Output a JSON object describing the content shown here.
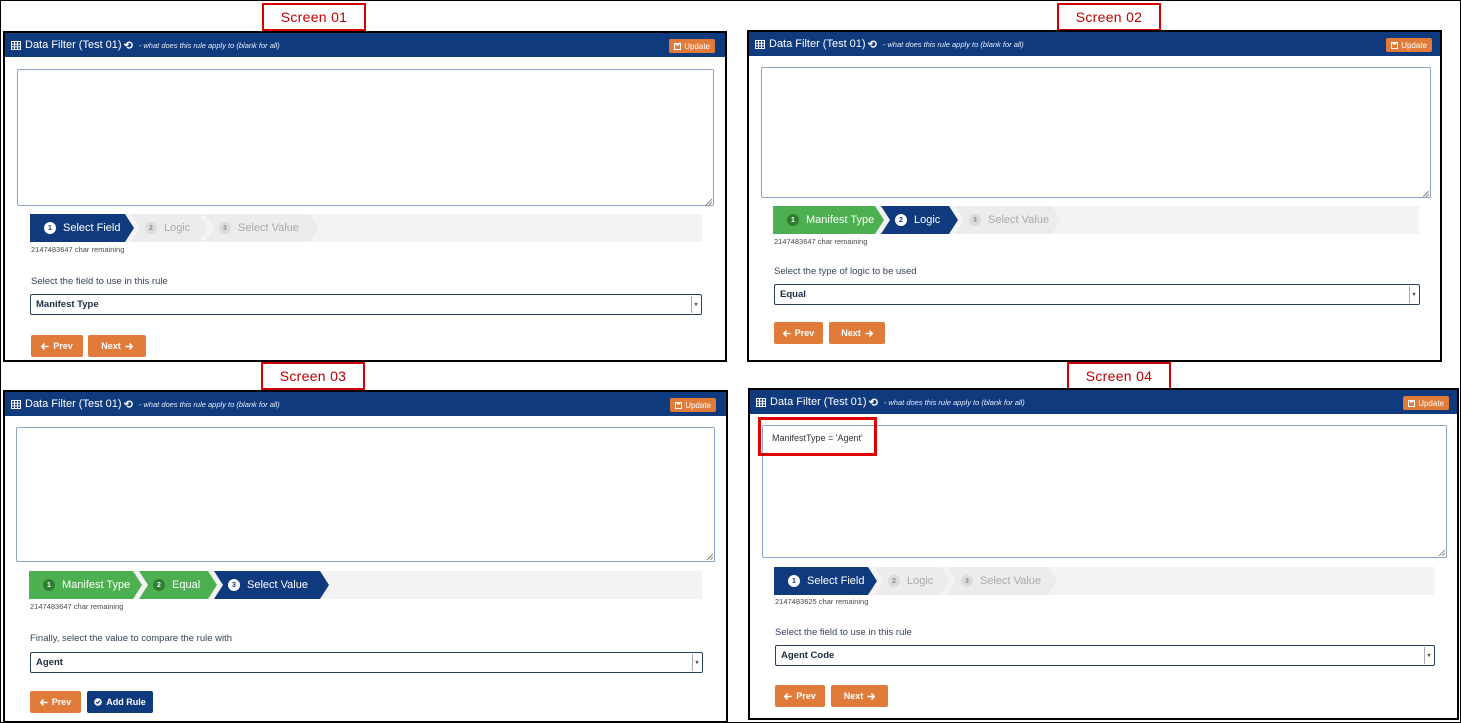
{
  "labels": {
    "screen1": "Screen 01",
    "screen2": "Screen 02",
    "screen3": "Screen 03",
    "screen4": "Screen 04"
  },
  "common": {
    "panel_title": "Data Filter (Test 01)",
    "history_glyph": "⟲",
    "hint": "- what does this rule apply to (blank for all)",
    "update_label": "Update",
    "prev_label": "Prev",
    "next_label": "Next",
    "add_rule_label": "Add Rule",
    "icons": {
      "header": "table-icon",
      "history": "history-icon",
      "update": "save-icon",
      "prev": "arrow-left-icon",
      "next": "arrow-right-icon",
      "add_rule": "check-circle-icon"
    },
    "colors": {
      "header": "#0f3a7e",
      "accent": "#e07b3a",
      "done": "#4caf50",
      "active": "#0f3a7e"
    }
  },
  "screen1": {
    "rule_text": "",
    "steps": [
      {
        "num": "1",
        "label": "Select Field",
        "state": "active"
      },
      {
        "num": "2",
        "label": "Logic",
        "state": "todo"
      },
      {
        "num": "3",
        "label": "Select Value",
        "state": "todo"
      }
    ],
    "remaining": "2147483647 char remaining",
    "prompt": "Select the field to use in this rule",
    "selected": "Manifest Type"
  },
  "screen2": {
    "rule_text": "",
    "steps": [
      {
        "num": "1",
        "label": "Manifest Type",
        "state": "done"
      },
      {
        "num": "2",
        "label": "Logic",
        "state": "active"
      },
      {
        "num": "3",
        "label": "Select Value",
        "state": "todo"
      }
    ],
    "remaining": "2147483647 char remaining",
    "prompt": "Select the type of logic to be used",
    "selected": "Equal"
  },
  "screen3": {
    "rule_text": "",
    "steps": [
      {
        "num": "1",
        "label": "Manifest Type",
        "state": "done"
      },
      {
        "num": "2",
        "label": "Equal",
        "state": "done"
      },
      {
        "num": "3",
        "label": "Select Value",
        "state": "active"
      }
    ],
    "remaining": "2147483647 char remaining",
    "prompt": "Finally, select the value to compare the rule with",
    "selected": "Agent"
  },
  "screen4": {
    "rule_text": "ManifestType = 'Agent'",
    "steps": [
      {
        "num": "1",
        "label": "Select Field",
        "state": "active"
      },
      {
        "num": "2",
        "label": "Logic",
        "state": "todo"
      },
      {
        "num": "3",
        "label": "Select Value",
        "state": "todo"
      }
    ],
    "remaining": "2147483625 char remaining",
    "prompt": "Select the field to use in this rule",
    "selected": "Agent Code"
  }
}
